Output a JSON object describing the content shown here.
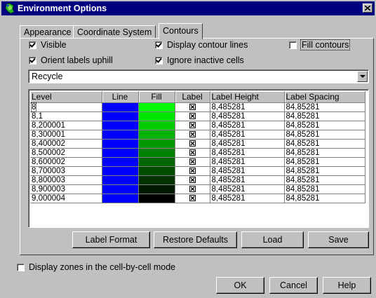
{
  "window": {
    "title": "Environment Options"
  },
  "tabs": [
    {
      "label": "Appearance",
      "active": false
    },
    {
      "label": "Coordinate System",
      "active": false
    },
    {
      "label": "Contours",
      "active": true
    }
  ],
  "options": {
    "visible": {
      "label": "Visible",
      "checked": true
    },
    "display_contour_lines": {
      "label": "Display contour lines",
      "checked": true
    },
    "fill_contours": {
      "label": "Fill contours",
      "checked": false
    },
    "orient_labels_uphill": {
      "label": "Orient labels uphill",
      "checked": true
    },
    "ignore_inactive_cells": {
      "label": "Ignore inactive cells",
      "checked": true
    }
  },
  "colormap": {
    "selected": "Recycle"
  },
  "grid": {
    "columns": [
      "Level",
      "Line",
      "Fill",
      "Label",
      "Label Height",
      "Label Spacing"
    ],
    "rows": [
      {
        "level": "8",
        "line_color": "#0000ff",
        "fill_color": "#00ff00",
        "label": true,
        "label_height": "8,485281",
        "label_spacing": "84,85281"
      },
      {
        "level": "8,1",
        "line_color": "#0000ff",
        "fill_color": "#00e600",
        "label": true,
        "label_height": "8,485281",
        "label_spacing": "84,85281"
      },
      {
        "level": "8,200001",
        "line_color": "#0000ff",
        "fill_color": "#00cc00",
        "label": true,
        "label_height": "8,485281",
        "label_spacing": "84,85281"
      },
      {
        "level": "8,300001",
        "line_color": "#0000ff",
        "fill_color": "#00b300",
        "label": true,
        "label_height": "8,485281",
        "label_spacing": "84,85281"
      },
      {
        "level": "8,400002",
        "line_color": "#0000ff",
        "fill_color": "#009900",
        "label": true,
        "label_height": "8,485281",
        "label_spacing": "84,85281"
      },
      {
        "level": "8,500002",
        "line_color": "#0000ff",
        "fill_color": "#008000",
        "label": true,
        "label_height": "8,485281",
        "label_spacing": "84,85281"
      },
      {
        "level": "8,600002",
        "line_color": "#0000ff",
        "fill_color": "#006600",
        "label": true,
        "label_height": "8,485281",
        "label_spacing": "84,85281"
      },
      {
        "level": "8,700003",
        "line_color": "#0000ff",
        "fill_color": "#004d00",
        "label": true,
        "label_height": "8,485281",
        "label_spacing": "84,85281"
      },
      {
        "level": "8,800003",
        "line_color": "#0000ff",
        "fill_color": "#003300",
        "label": true,
        "label_height": "8,485281",
        "label_spacing": "84,85281"
      },
      {
        "level": "8,900003",
        "line_color": "#0000ff",
        "fill_color": "#001a00",
        "label": true,
        "label_height": "8,485281",
        "label_spacing": "84,85281"
      },
      {
        "level": "9,000004",
        "line_color": "#0000ff",
        "fill_color": "#000000",
        "label": true,
        "label_height": "8,485281",
        "label_spacing": "84,85281"
      }
    ]
  },
  "panel_buttons": {
    "label_format": "Label Format",
    "restore_defaults": "Restore Defaults",
    "load": "Load",
    "save": "Save"
  },
  "display_zones": {
    "label": "Display zones in the cell-by-cell mode",
    "checked": false
  },
  "dialog_buttons": {
    "ok": "OK",
    "cancel": "Cancel",
    "help": "Help"
  }
}
